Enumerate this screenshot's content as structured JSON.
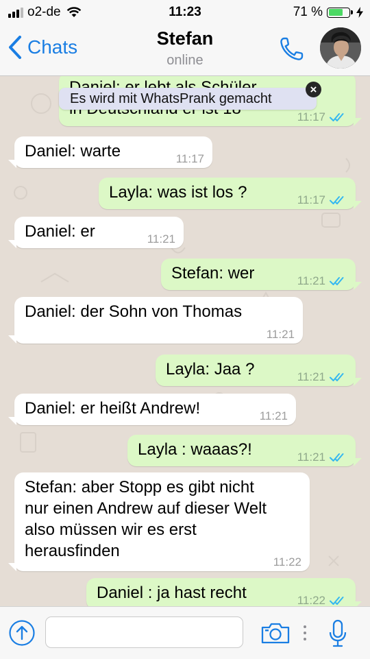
{
  "status_bar": {
    "carrier": "o2-de",
    "time": "11:23",
    "battery": "71 %",
    "battery_level": 0.71
  },
  "header": {
    "back_label": "Chats",
    "title": "Stefan",
    "subtitle": "online"
  },
  "toast": {
    "text": "Es wird mit WhatsPrank gemacht",
    "close_icon": "close-icon"
  },
  "messages": [
    {
      "direction": "out",
      "lines": [
        "Daniel: er lebt als Schüler",
        "in Deutschland er ist 18"
      ],
      "time": "11:17",
      "status": "read"
    },
    {
      "direction": "in",
      "lines": [
        "Daniel: warte"
      ],
      "time": "11:17"
    },
    {
      "direction": "out",
      "lines": [
        "Layla: was ist los ?"
      ],
      "time": "11:17",
      "status": "read"
    },
    {
      "direction": "in",
      "lines": [
        "Daniel: er"
      ],
      "time": "11:21"
    },
    {
      "direction": "out",
      "lines": [
        "Stefan: wer"
      ],
      "time": "11:21",
      "status": "read"
    },
    {
      "direction": "in",
      "lines": [
        "Daniel: der Sohn von Thomas"
      ],
      "time": "11:21"
    },
    {
      "direction": "out",
      "lines": [
        "Layla: Jaa ?"
      ],
      "time": "11:21",
      "status": "read"
    },
    {
      "direction": "in",
      "lines": [
        "Daniel: er heißt Andrew!"
      ],
      "time": "11:21"
    },
    {
      "direction": "out",
      "lines": [
        "Layla : waaas?!"
      ],
      "time": "11:21",
      "status": "read"
    },
    {
      "direction": "in",
      "lines": [
        "Stefan: aber Stopp es gibt nicht",
        "nur einen Andrew auf dieser Welt",
        "also müssen wir es erst",
        "herausfinden"
      ],
      "time": "11:22"
    },
    {
      "direction": "out",
      "lines": [
        "Daniel : ja hast recht"
      ],
      "time": "11:22",
      "status": "read"
    }
  ],
  "composer": {
    "placeholder": "",
    "value": ""
  },
  "colors": {
    "accent": "#1a7ee3",
    "outgoing_bubble": "#dcf8c6",
    "incoming_bubble": "#ffffff",
    "chat_background": "#e5ddd5",
    "read_ticks": "#34b7f1"
  },
  "icons": {
    "back": "chevron-left-icon",
    "call": "phone-icon",
    "attach": "upload-icon",
    "camera": "camera-icon",
    "more": "more-dots-icon",
    "mic": "microphone-icon"
  }
}
